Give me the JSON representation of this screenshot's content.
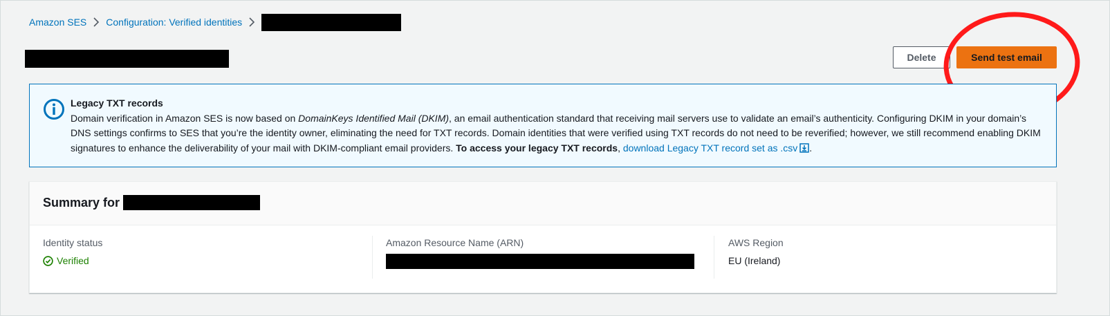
{
  "breadcrumb": {
    "items": [
      "Amazon SES",
      "Configuration: Verified identities"
    ]
  },
  "header": {
    "delete_label": "Delete",
    "send_test_email_label": "Send test email"
  },
  "alert": {
    "icon": "info-icon",
    "title": "Legacy TXT records",
    "text_part1": "Domain verification in Amazon SES is now based on ",
    "text_italic": "DomainKeys Identified Mail (DKIM)",
    "text_part2": ", an email authentication standard that receiving mail servers use to validate an email’s authenticity. Configuring DKIM in your domain’s DNS settings confirms to SES that you’re the identity owner, eliminating the need for TXT records. Domain identities that were verified using TXT records do not need to be reverified; however, we still recommend enabling DKIM signatures to enhance the deliverability of your mail with DKIM-compliant email providers. ",
    "text_bold": "To access your legacy TXT records",
    "text_comma": ", ",
    "link_label": "download Legacy TXT record set as .csv",
    "text_end": "."
  },
  "summary": {
    "title_prefix": "Summary for",
    "identity_status_label": "Identity status",
    "identity_status_value": "Verified",
    "arn_label": "Amazon Resource Name (ARN)",
    "region_label": "AWS Region",
    "region_value": "EU (Ireland)"
  },
  "colors": {
    "link": "#0073bb",
    "primary_button": "#ec7211",
    "alert_border": "#0073bb",
    "alert_background": "#f1faff",
    "success": "#1d8102",
    "annotation": "#ff0000"
  }
}
